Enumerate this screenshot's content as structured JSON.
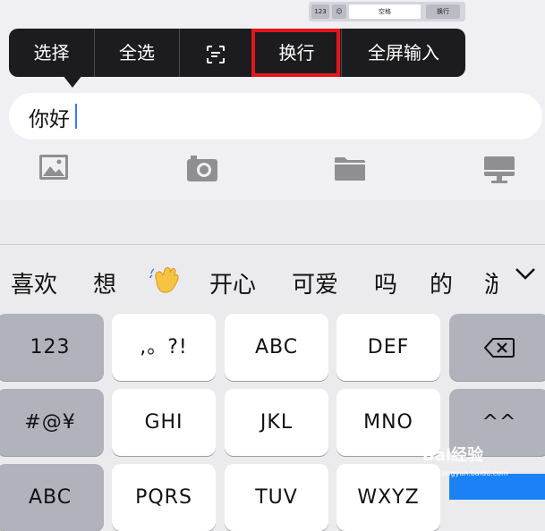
{
  "mini_toolbar": {
    "k1": "123",
    "k3": "空格",
    "k4": "换行"
  },
  "popup_menu": {
    "select": "选择",
    "select_all": "全选",
    "replace_line": "换行",
    "fullscreen": "全屏输入"
  },
  "input": {
    "value": "你好"
  },
  "attachments": {
    "icons": [
      "image-icon",
      "camera-icon",
      "folder-icon",
      "desktop-icon"
    ]
  },
  "candidates": {
    "words": [
      "喜欢",
      "想",
      "开心",
      "可爱",
      "吗",
      "的",
      "游"
    ]
  },
  "keyboard": {
    "row1": {
      "left": "123",
      "k1": ",。?!",
      "k2": "ABC",
      "k3": "DEF"
    },
    "row2": {
      "left": "#@¥",
      "k1": "GHI",
      "k2": "JKL",
      "k3": "MNO",
      "right": "^^"
    },
    "row3": {
      "left": "ABC",
      "k1": "PQRS",
      "k2": "TUV",
      "k3": "WXYZ"
    }
  },
  "watermark": {
    "text": "Bai经验",
    "url": "jingyan.baidu.com"
  },
  "colors": {
    "highlight": "#e3161c",
    "accent": "#1a82f5",
    "popup": "#1c1c1e"
  }
}
